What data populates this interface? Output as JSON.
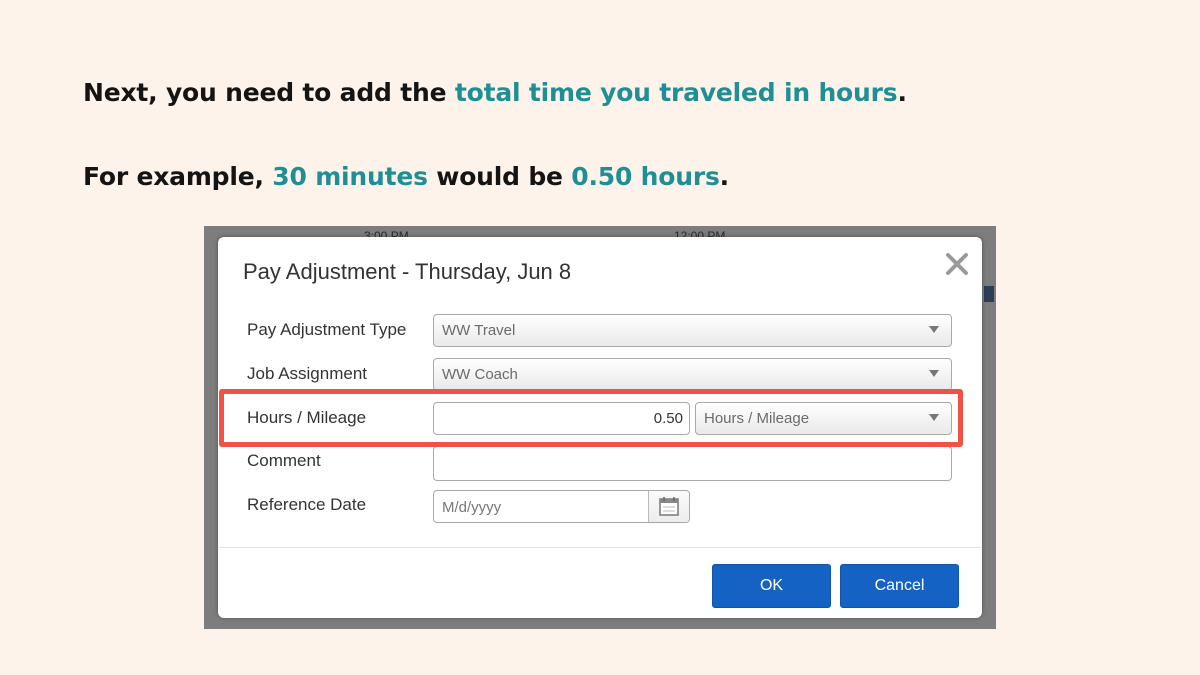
{
  "instructions": {
    "line1": {
      "pre": "Next, you need to add the ",
      "highlight": "total time you traveled in hours",
      "post": "."
    },
    "line2": {
      "pre": "For example, ",
      "highlight1": "30 minutes",
      "mid": " would be ",
      "highlight2": "0.50 hours",
      "post": "."
    }
  },
  "background": {
    "time_left": "3:00 PM",
    "time_right": "12:00 PM"
  },
  "dialog": {
    "title": "Pay Adjustment - Thursday, Jun 8",
    "fields": {
      "pay_adjustment_type": {
        "label": "Pay Adjustment Type",
        "value": "WW Travel"
      },
      "job_assignment": {
        "label": "Job Assignment",
        "value": "WW Coach"
      },
      "hours_mileage": {
        "label": "Hours / Mileage",
        "value": "0.50",
        "unit": "Hours / Mileage"
      },
      "comment": {
        "label": "Comment",
        "value": ""
      },
      "reference_date": {
        "label": "Reference Date",
        "placeholder": "M/d/yyyy"
      }
    },
    "buttons": {
      "ok": "OK",
      "cancel": "Cancel"
    }
  },
  "colors": {
    "highlight_text": "#1f8f96",
    "callout_border": "#ef5346",
    "primary_button": "#1463c4"
  }
}
